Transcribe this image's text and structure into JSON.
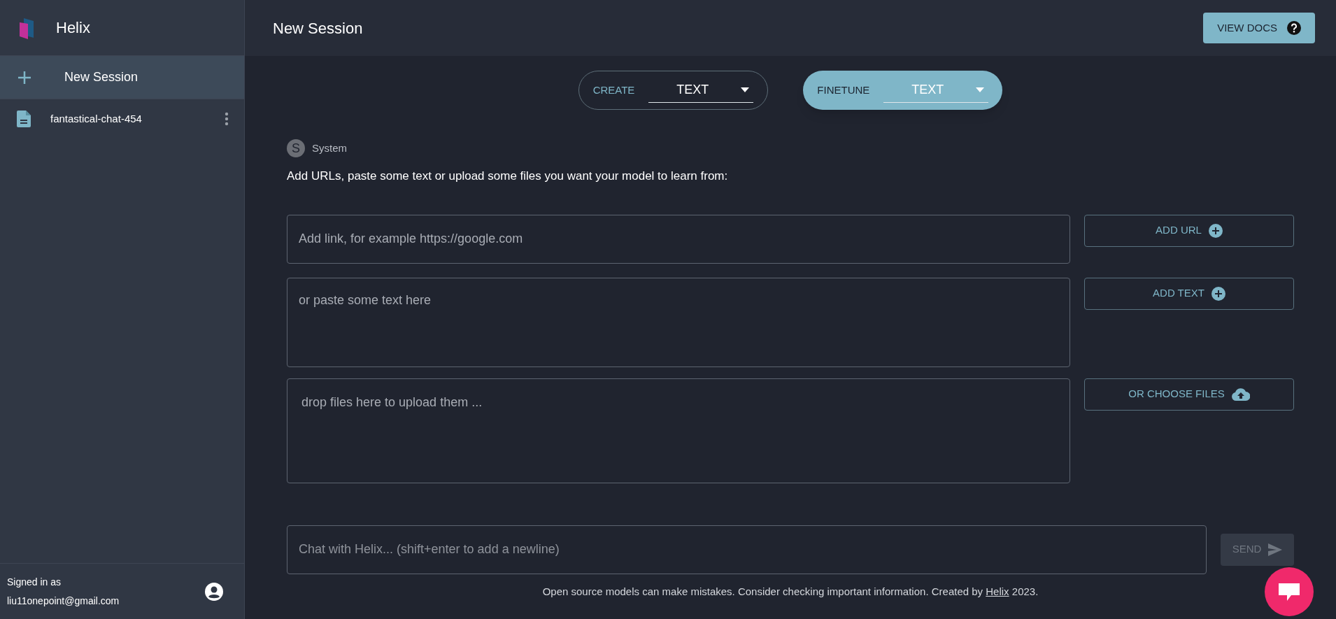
{
  "sidebar": {
    "app_name": "Helix",
    "new_session": {
      "label": "New Session",
      "selected": true
    },
    "sessions": [
      {
        "label": "fantastical-chat-454",
        "selected": false
      }
    ],
    "signed_in_label": "Signed in as",
    "email": "liu11onepoint@gmail.com"
  },
  "header": {
    "title": "New Session",
    "docs_button": "VIEW DOCS"
  },
  "modes": [
    {
      "label": "CREATE",
      "value": "TEXT",
      "selected": false
    },
    {
      "label": "FINETUNE",
      "value": "TEXT",
      "selected": true
    }
  ],
  "system": {
    "avatar": "S",
    "name": "System",
    "message": "Add URLs, paste some text or upload some files you want your model to learn from:"
  },
  "url_field": {
    "placeholder": "Add link, for example https://google.com"
  },
  "add_url_button": "ADD URL",
  "text_field": {
    "placeholder": "or paste some text here"
  },
  "add_text_button": "ADD TEXT",
  "drop_zone": {
    "label": "drop files here to upload them ..."
  },
  "choose_files_button": "OR CHOOSE FILES",
  "chat_field": {
    "placeholder": "Chat with Helix... (shift+enter to add a newline)"
  },
  "send_button": {
    "label": "SEND",
    "disabled": true
  },
  "footer": {
    "before": "Open source models can make mistakes. Consider checking important information. Created by",
    "link": "Helix",
    "after": "2023."
  }
}
